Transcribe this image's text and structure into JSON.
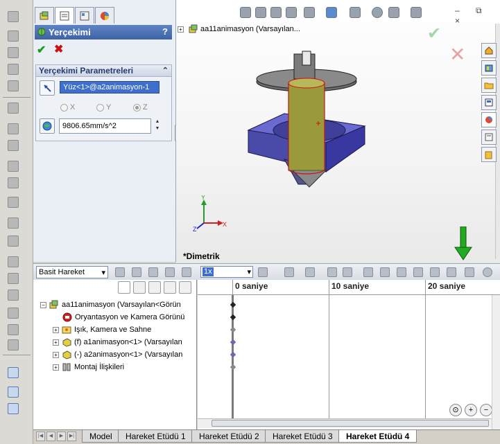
{
  "property_manager": {
    "title": "Yerçekimi",
    "help_label": "?",
    "group_title": "Yerçekimi Parametreleri",
    "face_selection": "Yüz<1>@a2animasyon-1",
    "axes": [
      "X",
      "Y",
      "Z"
    ],
    "selected_axis": "Z",
    "gravity_value": "9806.65mm/s^2"
  },
  "graphics": {
    "tree_root": "aa11animasyon  (Varsayılan...",
    "view_label": "*Dimetrik",
    "axes_labels": {
      "x": "X",
      "y": "Y",
      "z": "Z"
    },
    "window_buttons": "– ⧉ ×"
  },
  "motion": {
    "study_type": "Basit Hareket",
    "playback_speed": "1x",
    "time_labels": [
      "0 saniye",
      "10 saniye",
      "20 saniye"
    ],
    "tree": [
      {
        "label": "aa11animasyon  (Varsayılan<Görün",
        "icon": "assembly-icon",
        "expander": "−"
      },
      {
        "label": "Oryantasyon ve Kamera Görünü",
        "icon": "camera-orientation-icon",
        "expander": ""
      },
      {
        "label": "Işık, Kamera ve Sahne",
        "icon": "light-camera-icon",
        "expander": "+"
      },
      {
        "label": "(f) a1animasyon<1> (Varsayılan",
        "icon": "part-icon",
        "expander": "+"
      },
      {
        "label": "(-) a2animasyon<1> (Varsayılan",
        "icon": "part-icon",
        "expander": "+"
      },
      {
        "label": "Montaj İlişkileri",
        "icon": "mates-icon",
        "expander": "+"
      }
    ],
    "key_colors": [
      "#222222",
      "#222222",
      "#888888",
      "#6a6aa6",
      "#6a6aa6",
      "#888888"
    ]
  },
  "bottom_tabs": [
    "Model",
    "Hareket Etüdü 1",
    "Hareket Etüdü 2",
    "Hareket Etüdü 3",
    "Hareket Etüdü 4"
  ],
  "active_tab": "Hareket Etüdü 4",
  "colors": {
    "accent": "#3d63a6",
    "ok": "#1a9c1a",
    "cancel": "#cc1111",
    "part": "#4a4aa8",
    "shaft": "#9a9a3c"
  }
}
